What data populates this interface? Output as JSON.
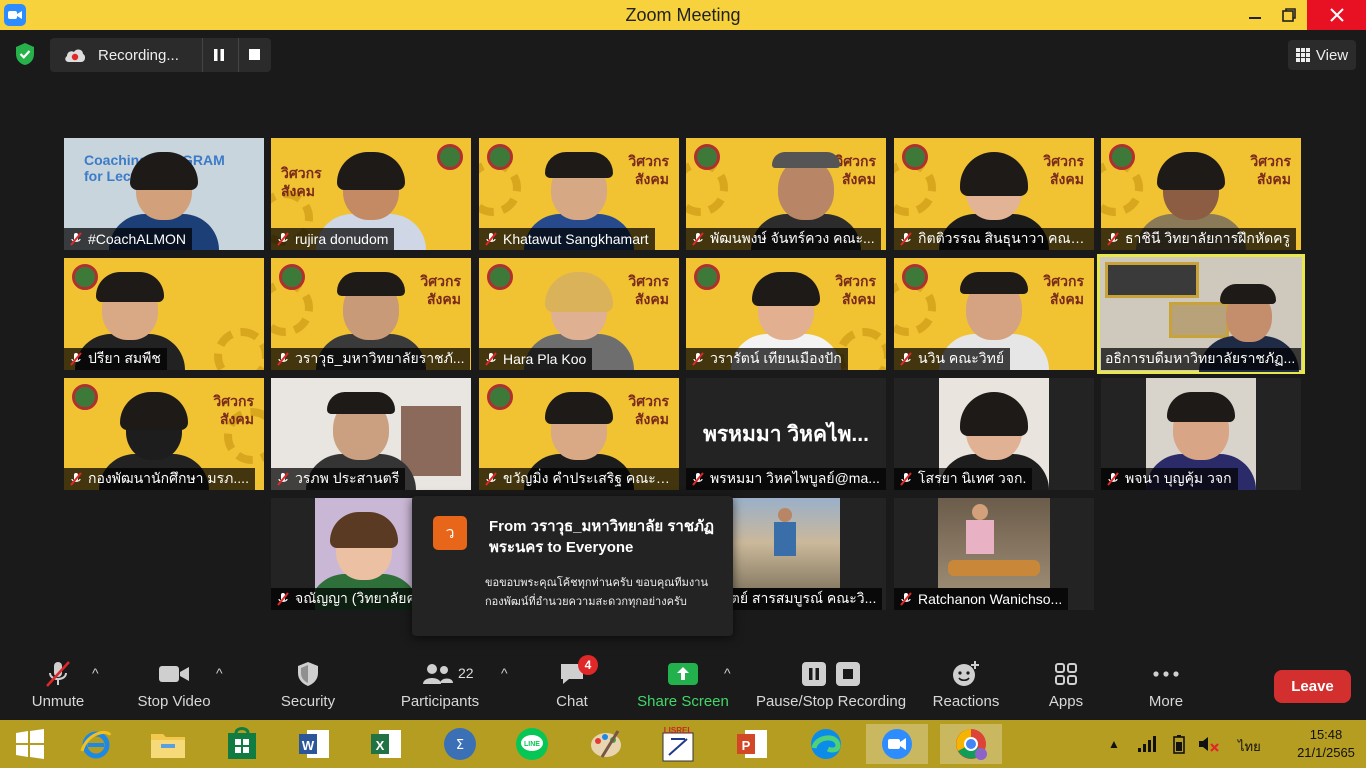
{
  "window": {
    "title": "Zoom Meeting"
  },
  "top": {
    "recording_label": "Recording...",
    "view_label": "View"
  },
  "tiles": [
    {
      "name": "#CoachALMON",
      "slide_text": "Coaching PROGRAM\nfor Lecturer"
    },
    {
      "name": "rujira donudom"
    },
    {
      "name": "Khatawut Sangkhamart"
    },
    {
      "name": "พัฒนพงษ์ จันทร์ควง คณะ..."
    },
    {
      "name": "กิตติวรรณ สินธุนาวา คณะ..."
    },
    {
      "name": "ธาชินี  วิทยาลัยการฝึกหัดครู"
    },
    {
      "name": "ปรียา สมพืช"
    },
    {
      "name": "วราวุธ_มหาวิทยาลัยราชภั..."
    },
    {
      "name": "Hara Pla Koo"
    },
    {
      "name": "วรารัตน์ เทียนเมืองปัก"
    },
    {
      "name": "นวิน คณะวิทย์"
    },
    {
      "name": "อธิการบดีมหาวิทยาลัยราชภัฏ..."
    },
    {
      "name": "กองพัฒนานักศึกษา มรภ...."
    },
    {
      "name": "วรภพ ประสานตรี"
    },
    {
      "name": "ขวัญมิ่ง คำประเสริฐ คณะวิ..."
    },
    {
      "name": "พรหมมา วิหคไพบูลย์@ma...",
      "big_name": "พรหมมา วิหคไพ..."
    },
    {
      "name": "โสรยา นิเทศ วจก."
    },
    {
      "name": "พจนา บุญคุ้ม วจก"
    },
    {
      "name": "จณัญญา (วิทยาลัยค"
    },
    {
      "name": "...ดิตย์ สารสมบูรณ์ คณะวิ..."
    },
    {
      "name": "Ratchanon Wanichso..."
    }
  ],
  "slide_deco": "วิศวกร\nสังคม",
  "chat_popup": {
    "avatar_letter": "ว",
    "from": "From วราวุธ_มหาวิทยาลัย ราชภัฏพระนคร to Everyone",
    "message": "ขอขอบพระคุณโค้ชทุกท่านครับ ขอบคุณทีมงานกองพัฒน์ที่อำนวยความสะดวกทุกอย่างครับ"
  },
  "toolbar": {
    "unmute": "Unmute",
    "stop_video": "Stop Video",
    "security": "Security",
    "participants": "Participants",
    "participants_count": "22",
    "chat": "Chat",
    "chat_badge": "4",
    "share_screen": "Share Screen",
    "pause_stop_recording": "Pause/Stop Recording",
    "reactions": "Reactions",
    "apps": "Apps",
    "more": "More",
    "leave": "Leave"
  },
  "taskbar": {
    "language": "ไทย",
    "time": "15:48",
    "date": "21/1/2565"
  },
  "colors": {
    "title_bar": "#f7d23c",
    "slide_bg": "#f1c232",
    "leave": "#d32f2f",
    "share_green": "#22b14c",
    "taskbar": "#b59d22"
  }
}
